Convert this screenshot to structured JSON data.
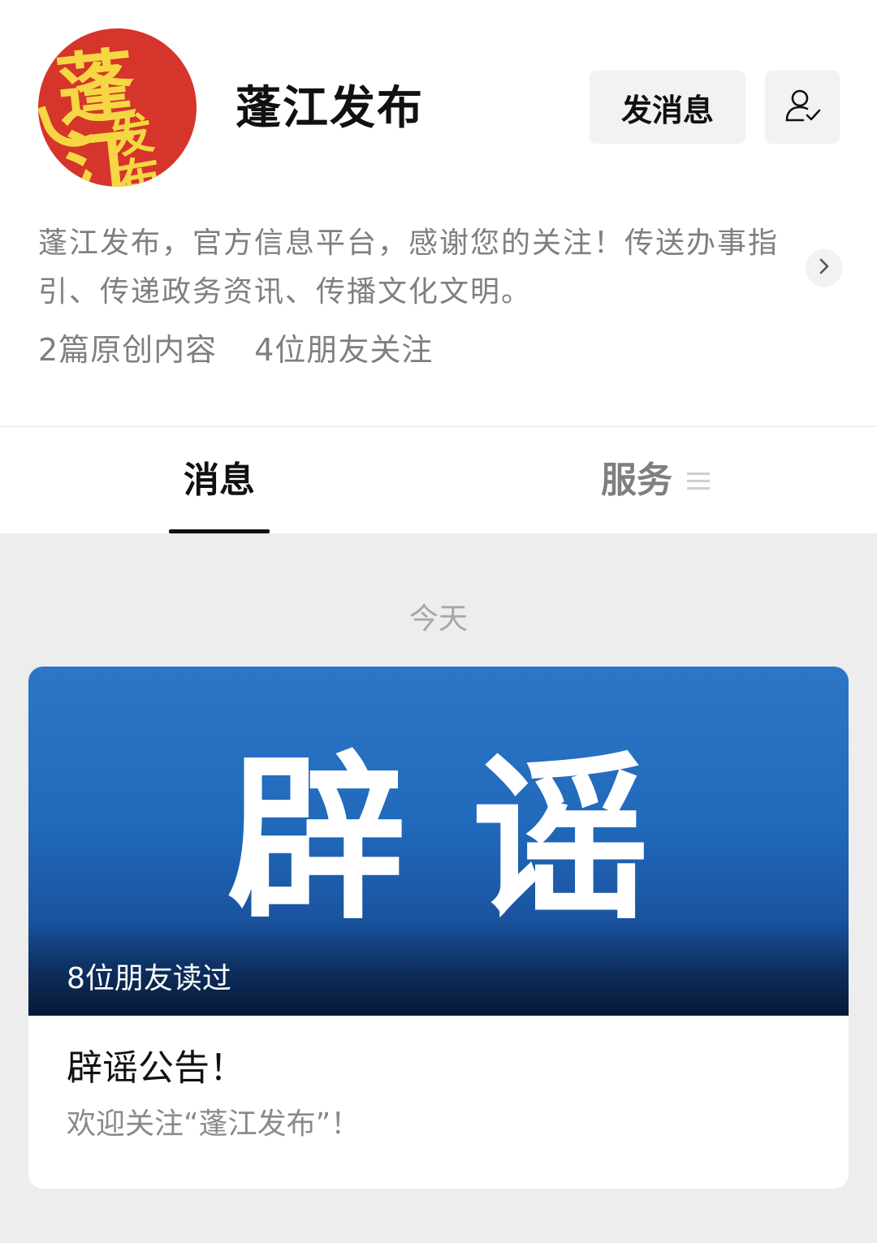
{
  "account": {
    "name": "蓬江发布",
    "avatar_text_main": "蓬江",
    "avatar_text_sub": "发布",
    "description": "蓬江发布，官方信息平台，感谢您的关注！传送办事指引、传递政务资讯、传播文化文明。",
    "stats": {
      "original": "2篇原创内容",
      "friends_following": "4位朋友关注"
    }
  },
  "actions": {
    "message_button": "发消息"
  },
  "tabs": {
    "messages": "消息",
    "services": "服务"
  },
  "feed": {
    "date_label": "今天",
    "article": {
      "cover_title": "辟谣",
      "read_count": "8位朋友读过",
      "title": "辟谣公告！",
      "summary": "欢迎关注“蓬江发布”！"
    }
  },
  "colors": {
    "avatar_bg": "#d5352b",
    "avatar_text": "#f4d742",
    "cover_blue": "#2c76c8"
  },
  "icons": {
    "followed": "user-check-icon",
    "arrow": "chevron-right-icon",
    "menu": "menu-icon"
  }
}
